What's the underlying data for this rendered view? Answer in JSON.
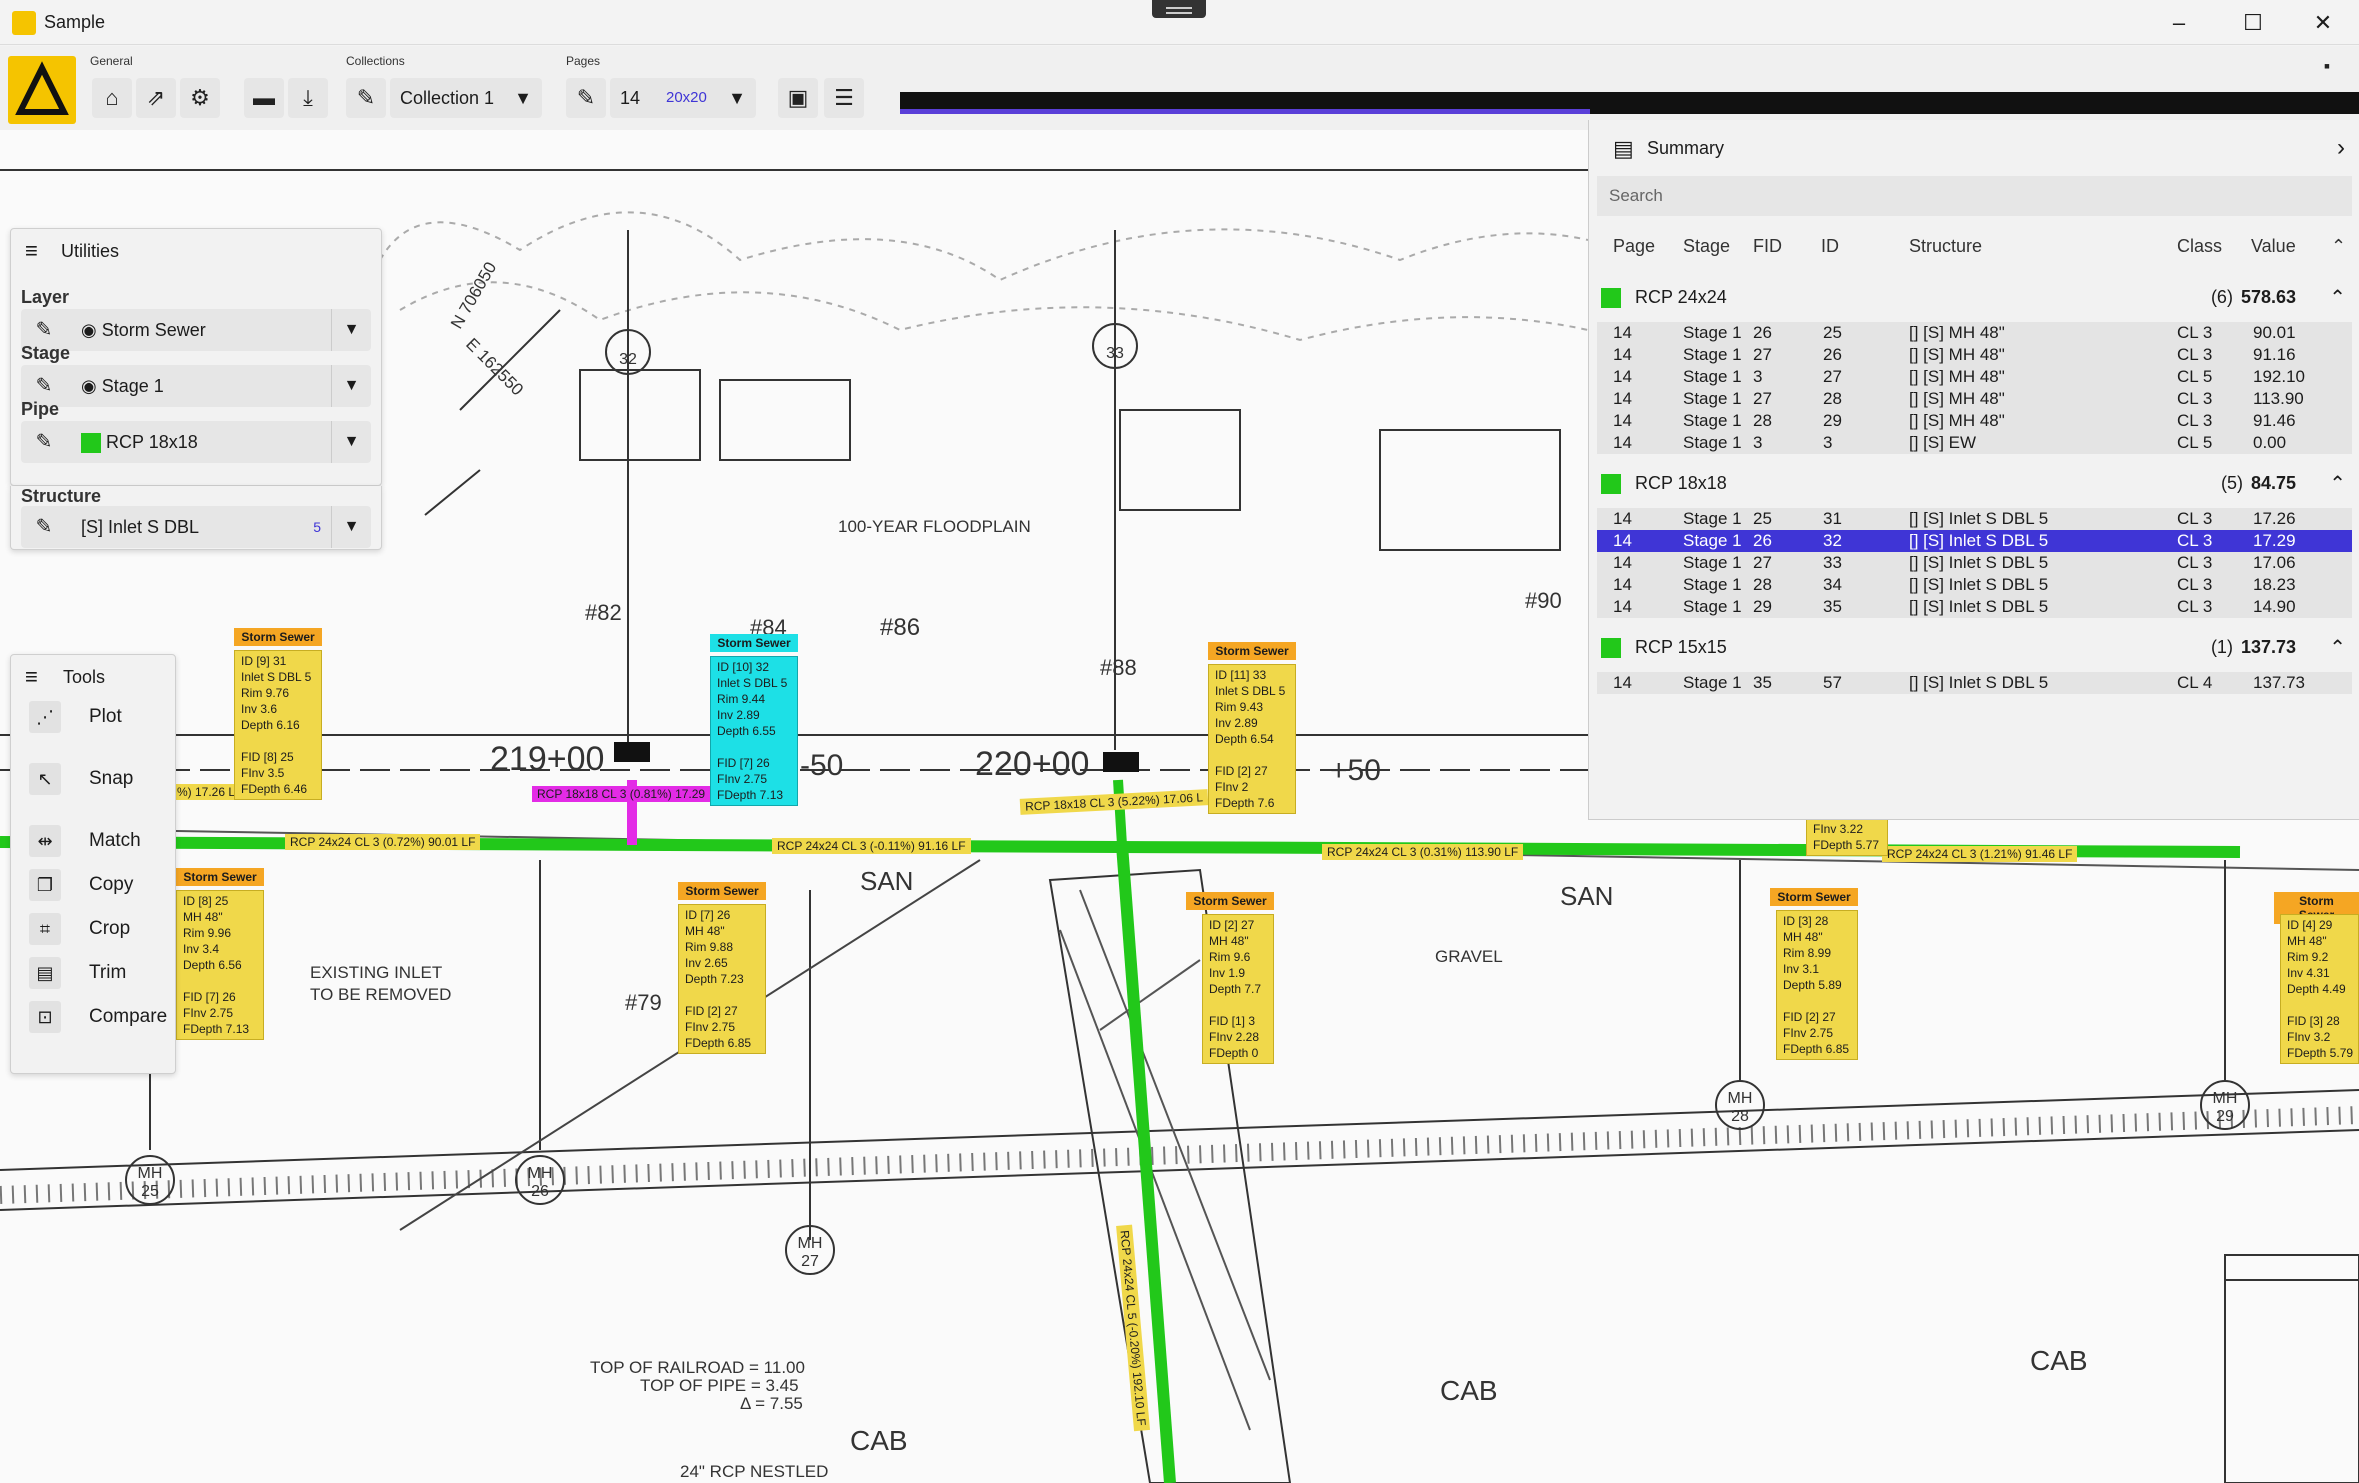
{
  "window": {
    "title": "Sample",
    "controls": [
      "–",
      "☐",
      "✕"
    ]
  },
  "ribbon": {
    "groups": [
      "General",
      "Collections",
      "Pages"
    ],
    "collection": "Collection 1",
    "page": "14",
    "scale": "20x20"
  },
  "utilities": {
    "title": "Utilities",
    "layer_label": "Layer",
    "layer": "Storm Sewer",
    "stage_label": "Stage",
    "stage": "Stage 1",
    "pipe_label": "Pipe",
    "pipe": "RCP 18x18",
    "pipe_color": "#22c81a",
    "structure_label": "Structure",
    "structure": "[S] Inlet S DBL",
    "structure_count": "5"
  },
  "tools": {
    "title": "Tools",
    "items": [
      "Plot",
      "Snap",
      "Match",
      "Copy",
      "Crop",
      "Trim",
      "Compare"
    ]
  },
  "summary": {
    "title": "Summary",
    "search_placeholder": "Search",
    "headers": [
      "Page",
      "Stage",
      "FID",
      "ID",
      "Structure",
      "Class",
      "Value"
    ],
    "groups": [
      {
        "name": "RCP 24x24",
        "count": "(6)",
        "total": "578.63",
        "rows": [
          [
            "14",
            "Stage 1",
            "26",
            "25",
            "[] [S] MH 48\"",
            "CL 3",
            "90.01"
          ],
          [
            "14",
            "Stage 1",
            "27",
            "26",
            "[] [S] MH 48\"",
            "CL 3",
            "91.16"
          ],
          [
            "14",
            "Stage 1",
            "3",
            "27",
            "[] [S] MH 48\"",
            "CL 5",
            "192.10"
          ],
          [
            "14",
            "Stage 1",
            "27",
            "28",
            "[] [S] MH 48\"",
            "CL 3",
            "113.90"
          ],
          [
            "14",
            "Stage 1",
            "28",
            "29",
            "[] [S] MH 48\"",
            "CL 3",
            "91.46"
          ],
          [
            "14",
            "Stage 1",
            "3",
            "3",
            "[] [S] EW",
            "CL 5",
            "0.00"
          ]
        ]
      },
      {
        "name": "RCP 18x18",
        "count": "(5)",
        "total": "84.75",
        "rows": [
          [
            "14",
            "Stage 1",
            "25",
            "31",
            "[] [S] Inlet S DBL 5",
            "CL 3",
            "17.26"
          ],
          [
            "14",
            "Stage 1",
            "26",
            "32",
            "[] [S] Inlet S DBL 5",
            "CL 3",
            "17.29"
          ],
          [
            "14",
            "Stage 1",
            "27",
            "33",
            "[] [S] Inlet S DBL 5",
            "CL 3",
            "17.06"
          ],
          [
            "14",
            "Stage 1",
            "28",
            "34",
            "[] [S] Inlet S DBL 5",
            "CL 3",
            "18.23"
          ],
          [
            "14",
            "Stage 1",
            "29",
            "35",
            "[] [S] Inlet S DBL 5",
            "CL 3",
            "14.90"
          ]
        ]
      },
      {
        "name": "RCP 15x15",
        "count": "(1)",
        "total": "137.73",
        "rows": [
          [
            "14",
            "Stage 1",
            "35",
            "57",
            "[] [S] Inlet S DBL 5",
            "CL 4",
            "137.73"
          ]
        ]
      }
    ],
    "selected_row": "1-1"
  },
  "drawing": {
    "texts": {
      "floodplain": "100-YEAR FLOODPLAIN",
      "sta1": "219+00",
      "sta2": "220+00",
      "p50a": "-50",
      "p50b": "+50",
      "existing": "EXISTING INLET\nTO BE REMOVED",
      "rr1": "TOP OF RAILROAD  =    11.00",
      "rr2": "TOP OF PIPE  =    3.45",
      "rr3": "Δ  =    7.55",
      "nestled": "24\" RCP NESTLED",
      "n706": "N 706050",
      "e162": "E 162550",
      "cab1": "CAB",
      "cab2": "CAB",
      "cab3": "CAB",
      "san1": "SAN",
      "san2": "SAN",
      "gravel": "GRAVEL",
      "h86": "#86",
      "h82": "#82",
      "h84": "#84",
      "h79": "#79",
      "h88": "#88",
      "h90": "#90"
    },
    "bubbles": [
      {
        "t": "32"
      },
      {
        "t": "33"
      }
    ],
    "mh": [
      {
        "t": "MH\n25"
      },
      {
        "t": "MH\n26"
      },
      {
        "t": "MH\n27"
      },
      {
        "t": "MH\n28"
      },
      {
        "t": "MH\n29"
      }
    ],
    "pipes": [
      "RCP 24x24 CL 3 (0.72%) 90.01 LF",
      "RCP 24x24 CL 3 (-0.11%) 91.16 LF",
      "RCP 24x24 CL 3 (0.31%) 113.90 LF",
      "RCP 24x24 CL 3 (1.21%) 91.46 LF",
      "RCP 18x18 CL 3 (0.81%) 17.29",
      "RCP 18x18 CL 3 (5.22%) 17.06 L",
      "%) 17.26 L",
      "RCP 24x24 CL 5 (-0.20%) 192.10 LF"
    ],
    "labels": [
      {
        "h": "Storm Sewer",
        "b": "ID [9] 31\nInlet S DBL 5\nRim 9.76\nInv 3.6\nDepth 6.16\n\nFID [8] 25\nFInv 3.5\nFDepth 6.46"
      },
      {
        "h": "Storm Sewer",
        "b": "ID [10] 32\nInlet S DBL 5\nRim 9.44\nInv 2.89\nDepth 6.55\n\nFID [7] 26\nFInv 2.75\nFDepth 7.13"
      },
      {
        "h": "Storm Sewer",
        "b": "ID [11] 33\nInlet S DBL 5\nRim 9.43\nInv 2.89\nDepth 6.54\n\nFID [2] 27\nFInv 2\nFDepth 7.6"
      },
      {
        "h": "Storm Sewer",
        "b": "ID [8] 25\nMH 48\"\nRim 9.96\nInv 3.4\nDepth 6.56\n\nFID [7] 26\nFInv 2.75\nFDepth 7.13"
      },
      {
        "h": "Storm Sewer",
        "b": "ID [7] 26\nMH 48\"\nRim 9.88\nInv 2.65\nDepth 7.23\n\nFID [2] 27\nFInv 2.75\nFDepth 6.85"
      },
      {
        "h": "Storm Sewer",
        "b": "ID [2] 27\nMH 48\"\nRim 9.6\nInv 1.9\nDepth 7.7\n\nFID [1] 3\nFInv 2.28\nFDepth 0"
      },
      {
        "h": "Storm Sewer",
        "b": "ID [3] 28\nMH 48\"\nRim 8.99\nInv 3.1\nDepth 5.89\n\nFID [2] 27\nFInv 2.75\nFDepth 6.85"
      },
      {
        "h": "Storm Sewer",
        "b": "ID [4] 29\nMH 48\"\nRim 9.2\nInv 4.31\nDepth 4.49\n\nFID [3] 28\nFInv 3.2\nFDepth 5.79"
      },
      {
        "h": "",
        "b": "FInv 3.22\nFDepth 5.77"
      }
    ]
  }
}
